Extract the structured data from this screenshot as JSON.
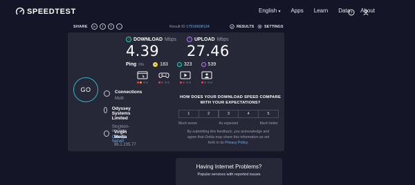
{
  "nav": {
    "logo_text": "SPEEDTEST",
    "language": "English",
    "links": [
      "Apps",
      "Learn",
      "Data",
      "About"
    ],
    "icons": [
      "speedometer-icon",
      "help-icon",
      "user-icon"
    ]
  },
  "toolbar": {
    "share_label": "SHARE",
    "result_id_label": "Result ID",
    "result_id": "17516608124",
    "results_label": "RESULTS",
    "settings_label": "SETTINGS"
  },
  "download": {
    "label": "DOWNLOAD",
    "unit": "Mbps",
    "value": "4.39"
  },
  "upload": {
    "label": "UPLOAD",
    "unit": "Mbps",
    "value": "27.46"
  },
  "ping": {
    "label": "Ping",
    "unit": "ms",
    "idle": "183",
    "download": "323",
    "upload": "539"
  },
  "app_ratings": [
    {
      "icon": "browsing-icon",
      "dots": [
        "#e8424d",
        "#f2a64a",
        "#4c4d60",
        "#4c4d60"
      ]
    },
    {
      "icon": "gaming-icon",
      "dots": [
        "#e8424d",
        "#4c4d60",
        "#4c4d60",
        "#4c4d60"
      ]
    },
    {
      "icon": "video-icon",
      "dots": [
        "#e8424d",
        "#4c4d60",
        "#4c4d60",
        "#4c4d60"
      ]
    },
    {
      "icon": "video-chat-icon",
      "dots": [
        "#e8424d",
        "#4c4d60",
        "#4c4d60",
        "#4c4d60"
      ]
    }
  ],
  "go_label": "GO",
  "connections": {
    "title": "Connections",
    "value": "Multi"
  },
  "server": {
    "title": "Odyssey Systems Limited",
    "location": "Stockton-on-Tees",
    "change": "Change Server"
  },
  "isp": {
    "title": "Virgin Media",
    "ip": "86.1.235.77"
  },
  "survey": {
    "question_1": "HOW DOES YOUR DOWNLOAD SPEED COMPARE",
    "question_2": "WITH YOUR EXPECTATIONS?",
    "options": [
      "1",
      "2",
      "3",
      "4",
      "5"
    ],
    "label_low": "Much worse",
    "label_mid": "As expected",
    "label_high": "Much better",
    "note_1": "By submitting this feedback, you acknowledge and",
    "note_2": "agree that Ookla may share this information as set",
    "note_3_prefix": "forth in its",
    "note_3_link": "Privacy Policy.",
    "note_3_suffix": ""
  },
  "problems": {
    "title": "Having Internet Problems?",
    "subtitle": "Popular services with reported issues"
  },
  "colors": {
    "background": "#141526",
    "card": "#262737",
    "download_accent": "#2fd7b7",
    "upload_accent": "#b77bff",
    "go_ring": "#2fb7c9",
    "link": "#62b6ff"
  }
}
